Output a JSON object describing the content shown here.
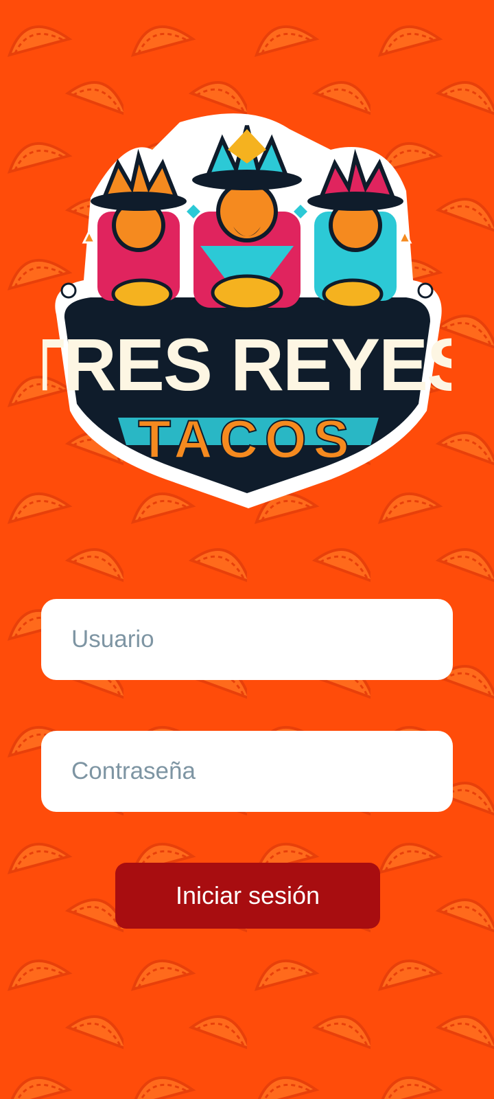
{
  "app": {
    "brand_line1": "TRES REYES",
    "brand_line2": "TACOS"
  },
  "login": {
    "username_placeholder": "Usuario",
    "username_value": "",
    "password_placeholder": "Contraseña",
    "password_value": "",
    "submit_label": "Iniciar sesión"
  },
  "colors": {
    "background": "#ff4c0a",
    "pattern": "#ff6a1c",
    "pattern_stroke": "#e8400a",
    "input_background": "#ffffff",
    "placeholder": "#7e95a3",
    "button": "#a80d10",
    "button_text": "#ffffff",
    "logo_dark": "#0f1c2b",
    "logo_cream": "#fdf6e3",
    "logo_cyan": "#2cc9d6",
    "logo_orange": "#f58a1f",
    "logo_pink": "#e0245e"
  },
  "icons": {
    "background": "taco-pattern",
    "logo": "three-kings-logo"
  }
}
